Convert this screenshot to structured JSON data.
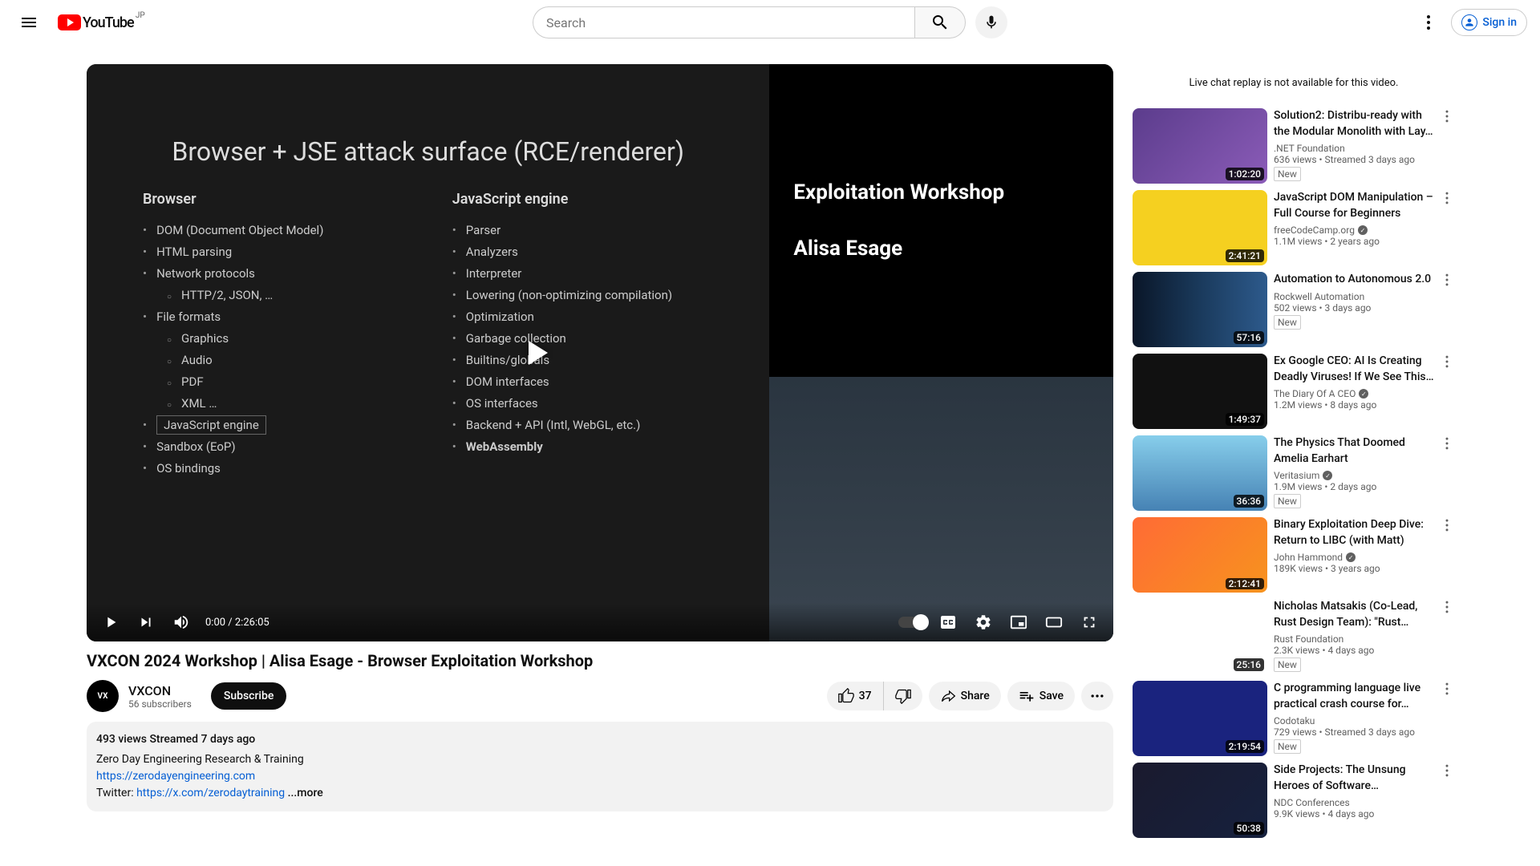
{
  "header": {
    "logo_text": "YouTube",
    "logo_cc": "JP",
    "search_placeholder": "Search",
    "signin_label": "Sign in"
  },
  "player": {
    "slide_title": "Browser + JSE attack surface (RCE/renderer)",
    "col1_heading": "Browser",
    "col1_items": [
      "DOM (Document Object Model)",
      "HTML parsing",
      "Network protocols"
    ],
    "col1_sub": [
      "HTTP/2, JSON, …"
    ],
    "col1_items2": [
      "File formats"
    ],
    "col1_sub2": [
      "Graphics",
      "Audio",
      "PDF",
      "XML …"
    ],
    "col1_items3": [
      "JavaScript engine",
      "Sandbox (EoP)",
      "OS bindings"
    ],
    "col2_heading": "JavaScript engine",
    "col2_items": [
      "Parser",
      "Analyzers",
      "Interpreter",
      "Lowering (non-optimizing compilation)",
      "Optimization",
      "Garbage collection",
      "Builtins/globals",
      "DOM interfaces",
      "OS interfaces",
      "Backend + API (Intl, WebGL, etc.)",
      "WebAssembly"
    ],
    "overlay_title1": "Exploitation Workshop",
    "overlay_title2": "Alisa Esage",
    "time": "0:00 / 2:26:05"
  },
  "video": {
    "title": "VXCON 2024 Workshop | Alisa Esage - Browser Exploitation Workshop",
    "channel_name": "VXCON",
    "channel_subs": "56 subscribers",
    "subscribe_label": "Subscribe",
    "like_count": "37",
    "share_label": "Share",
    "save_label": "Save"
  },
  "description": {
    "stats": "493 views  Streamed 7 days ago",
    "line1": "Zero Day Engineering Research & Training",
    "link1": "https://zerodayengineering.com",
    "twitter_prefix": "Twitter: ",
    "link2": "https://x.com/zerodaytraining",
    "more": "...more"
  },
  "chat_notice": "Live chat replay is not available for this video.",
  "related": [
    {
      "title": "Solution2: Distribu-ready with the Modular Monolith with Lay…",
      "channel": ".NET Foundation",
      "verified": false,
      "meta": "636 views  • Streamed 3 days ago",
      "duration": "1:02:20",
      "new": true,
      "thumb": "t1"
    },
    {
      "title": "JavaScript DOM Manipulation – Full Course for Beginners",
      "channel": "freeCodeCamp.org",
      "verified": true,
      "meta": "1.1M views  • 2 years ago",
      "duration": "2:41:21",
      "new": false,
      "thumb": "t2"
    },
    {
      "title": "Automation to Autonomous 2.0",
      "channel": "Rockwell Automation",
      "verified": false,
      "meta": "502 views  • 3 days ago",
      "duration": "57:16",
      "new": true,
      "thumb": "t3"
    },
    {
      "title": "Ex Google CEO: AI Is Creating Deadly Viruses! If We See This…",
      "channel": "The Diary Of A CEO",
      "verified": true,
      "meta": "1.2M views  • 8 days ago",
      "duration": "1:49:37",
      "new": false,
      "thumb": "t4"
    },
    {
      "title": "The Physics That Doomed Amelia Earhart",
      "channel": "Veritasium",
      "verified": true,
      "meta": "1.9M views  • 2 days ago",
      "duration": "36:36",
      "new": true,
      "thumb": "t5"
    },
    {
      "title": "Binary Exploitation Deep Dive: Return to LIBC (with Matt)",
      "channel": "John Hammond",
      "verified": true,
      "meta": "189K views  • 3 years ago",
      "duration": "2:12:41",
      "new": false,
      "thumb": "t6"
    },
    {
      "title": "Nicholas Matsakis (Co-Lead, Rust Design Team): \"Rust…",
      "channel": "Rust Foundation",
      "verified": false,
      "meta": "2.3K views  • 4 days ago",
      "duration": "25:16",
      "new": true,
      "thumb": "t7"
    },
    {
      "title": "C programming language live practical crash course for…",
      "channel": "Codotaku",
      "verified": false,
      "meta": "729 views  • Streamed 3 days ago",
      "duration": "2:19:54",
      "new": true,
      "thumb": "t8"
    },
    {
      "title": "Side Projects: The Unsung Heroes of Software…",
      "channel": "NDC Conferences",
      "verified": false,
      "meta": "9.9K views  • 4 days ago",
      "duration": "50:38",
      "new": false,
      "thumb": "t9"
    }
  ]
}
